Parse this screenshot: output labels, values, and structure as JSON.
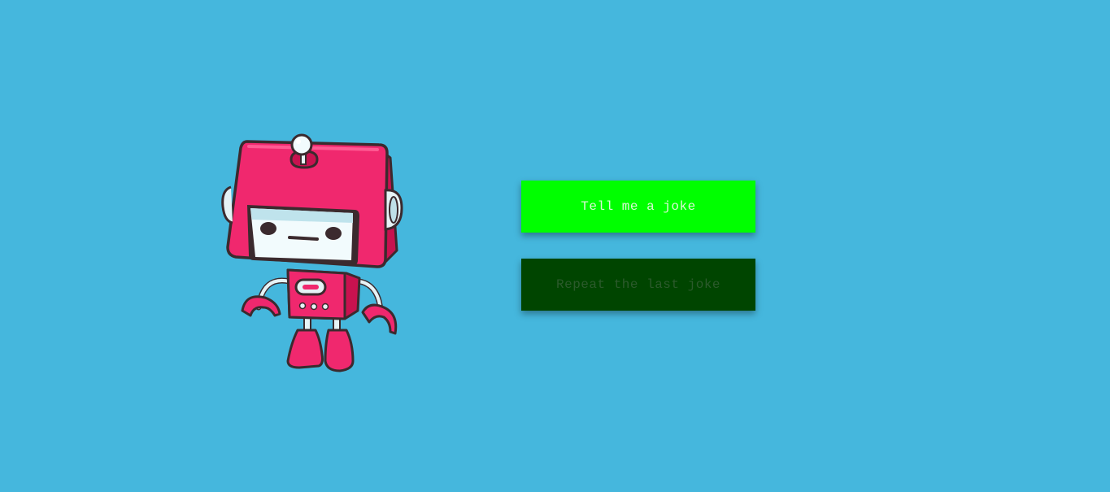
{
  "buttons": {
    "tell_joke": "Tell me a joke",
    "repeat_joke": "Repeat the last joke"
  },
  "robot": {
    "icon": "robot-icon"
  },
  "colors": {
    "background": "#45b7dd",
    "joke_button": "#00ff00",
    "repeat_button": "#004500",
    "robot_body": "#f0286e",
    "robot_dark": "#c8124f"
  }
}
